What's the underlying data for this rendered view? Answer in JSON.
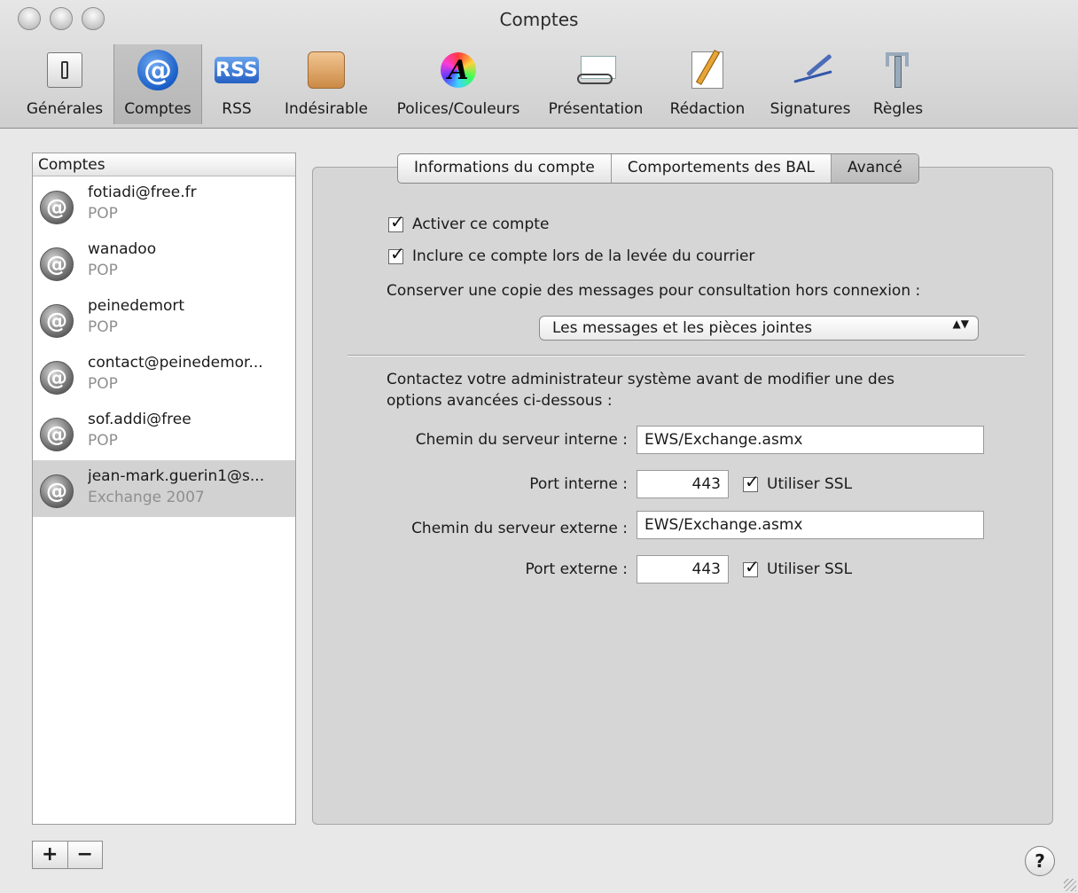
{
  "window": {
    "title": "Comptes"
  },
  "toolbar": {
    "items": [
      {
        "label": "Générales",
        "icon": "general-switch-icon"
      },
      {
        "label": "Comptes",
        "icon": "at-sign-icon",
        "selected": true
      },
      {
        "label": "RSS",
        "icon": "rss-icon"
      },
      {
        "label": "Indésirable",
        "icon": "junk-mail-icon"
      },
      {
        "label": "Polices/Couleurs",
        "icon": "fonts-colors-icon"
      },
      {
        "label": "Présentation",
        "icon": "viewing-glasses-icon"
      },
      {
        "label": "Rédaction",
        "icon": "composing-pencil-icon"
      },
      {
        "label": "Signatures",
        "icon": "signature-pen-icon"
      },
      {
        "label": "Règles",
        "icon": "rules-icon"
      }
    ],
    "rss_glyph": "RSS",
    "at_glyph": "@",
    "font_glyph": "A"
  },
  "accounts": {
    "header": "Comptes",
    "items": [
      {
        "name": "fotiadi@free.fr",
        "type": "POP"
      },
      {
        "name": "wanadoo",
        "type": "POP"
      },
      {
        "name": "peinedemort",
        "type": "POP"
      },
      {
        "name": "contact@peinedemor...",
        "type": "POP"
      },
      {
        "name": "sof.addi@free",
        "type": "POP"
      },
      {
        "name": "jean-mark.guerin1@s...",
        "type": "Exchange 2007",
        "selected": true
      }
    ],
    "avatar_glyph": "@",
    "add_label": "+",
    "remove_label": "−"
  },
  "tabs": {
    "items": [
      "Informations du compte",
      "Comportements des BAL",
      "Avancé"
    ],
    "active_index": 2
  },
  "advanced": {
    "enable_account": {
      "label": "Activer ce compte",
      "checked": true
    },
    "include_in_check": {
      "label": "Inclure ce compte lors de la levée du courrier",
      "checked": true
    },
    "offline_copy_label": "Conserver une copie des messages pour consultation hors connexion :",
    "offline_copy_value": "Les messages et les pièces jointes",
    "admin_note_line1": "Contactez votre administrateur système avant de modifier une des",
    "admin_note_line2": "options avancées ci-dessous :",
    "internal_path_label": "Chemin du serveur interne :",
    "internal_path_value": "EWS/Exchange.asmx",
    "internal_port_label": "Port interne :",
    "internal_port_value": "443",
    "external_path_label": "Chemin du serveur externe :",
    "external_path_value": "EWS/Exchange.asmx",
    "external_port_label": "Port externe :",
    "external_port_value": "443",
    "use_ssl_label": "Utiliser SSL",
    "internal_ssl_checked": true,
    "external_ssl_checked": true
  },
  "help": {
    "label": "?"
  },
  "check_glyph": "✓",
  "select_arrows": "▲▼"
}
